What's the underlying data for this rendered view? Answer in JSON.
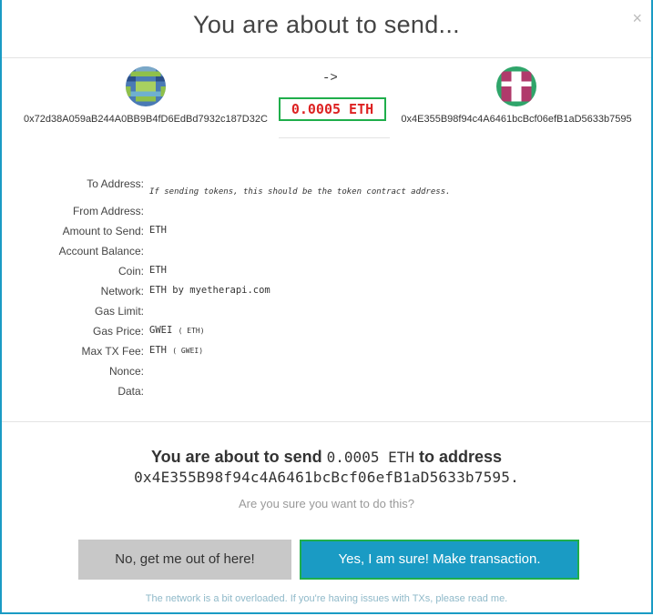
{
  "title": "You are about to send...",
  "close_glyph": "×",
  "from": {
    "address": "0x72d38A059aB244A0BB9B4fD6EdBd7932c187D32C",
    "avatar": "blockie-icon"
  },
  "to": {
    "address": "0x4E355B98f94c4A6461bcBcf06efB1aD5633b7595",
    "avatar": "blockie-icon"
  },
  "arrow": "->",
  "amount": "0.0005 ETH",
  "details": [
    {
      "label": "To Address:",
      "value": "If sending tokens, this should be the token contract address."
    },
    {
      "label": "From Address:",
      "value": ""
    },
    {
      "label": "Amount to Send:",
      "value": "ETH"
    },
    {
      "label": "Account Balance:",
      "value": ""
    },
    {
      "label": "Coin:",
      "value": "ETH"
    },
    {
      "label": "Network:",
      "value": "ETH by myetherapi.com"
    },
    {
      "label": "Gas Limit:",
      "value": ""
    },
    {
      "label": "Gas Price:",
      "value": "GWEI",
      "sub": "( ETH)"
    },
    {
      "label": "Max TX Fee:",
      "value": "ETH",
      "sub": "( GWEI)"
    },
    {
      "label": "Nonce:",
      "value": ""
    },
    {
      "label": "Data:",
      "value": ""
    }
  ],
  "confirm": {
    "prefix": "You are about to send",
    "amount": "0.0005 ETH",
    "mid": "to address",
    "address": "0x4E355B98f94c4A6461bcBcf06efB1aD5633b7595."
  },
  "question": "Are you sure you want to do this?",
  "buttons": {
    "no": "No, get me out of here!",
    "yes": "Yes, I am sure! Make transaction."
  },
  "footer": "The network is a bit overloaded. If you're having issues with TXs, please read me.",
  "colors": {
    "accent": "#1a9bc4",
    "highlight": "#1fae4b",
    "amount": "#dd2222"
  }
}
